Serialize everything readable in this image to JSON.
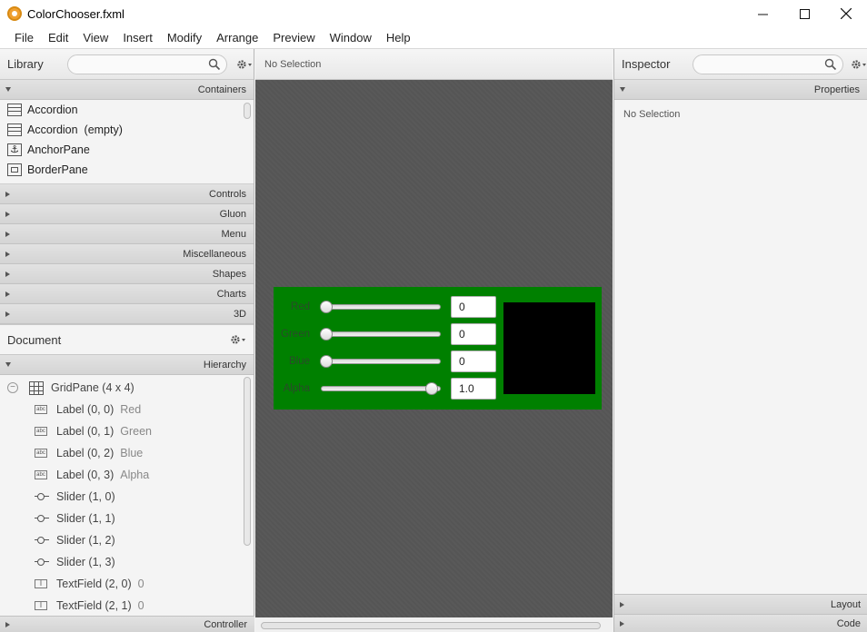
{
  "window": {
    "title": "ColorChooser.fxml"
  },
  "menu": [
    "File",
    "Edit",
    "View",
    "Insert",
    "Modify",
    "Arrange",
    "Preview",
    "Window",
    "Help"
  ],
  "library": {
    "title": "Library",
    "search_placeholder": "",
    "sections": {
      "containers": "Containers",
      "controls": "Controls",
      "gluon": "Gluon",
      "menu": "Menu",
      "misc": "Miscellaneous",
      "shapes": "Shapes",
      "charts": "Charts",
      "three_d": "3D"
    },
    "containers": [
      {
        "label": "Accordion",
        "icon": "accordion-icon"
      },
      {
        "label": "Accordion  (empty)",
        "icon": "accordion-icon"
      },
      {
        "label": "AnchorPane",
        "icon": "anchor-icon"
      },
      {
        "label": "BorderPane",
        "icon": "borderpane-icon"
      }
    ]
  },
  "document": {
    "title": "Document",
    "hierarchy_label": "Hierarchy",
    "controller_label": "Controller",
    "items": [
      {
        "label": "GridPane (4 x 4)",
        "extra": ""
      },
      {
        "label": "Label (0, 0)",
        "extra": "Red"
      },
      {
        "label": "Label (0, 1)",
        "extra": "Green"
      },
      {
        "label": "Label (0, 2)",
        "extra": "Blue"
      },
      {
        "label": "Label (0, 3)",
        "extra": "Alpha"
      },
      {
        "label": "Slider (1, 0)",
        "extra": ""
      },
      {
        "label": "Slider (1, 1)",
        "extra": ""
      },
      {
        "label": "Slider (1, 2)",
        "extra": ""
      },
      {
        "label": "Slider (1, 3)",
        "extra": ""
      },
      {
        "label": "TextField (2, 0)",
        "extra": "0"
      },
      {
        "label": "TextField (2, 1)",
        "extra": "0"
      }
    ]
  },
  "center": {
    "selection": "No Selection",
    "form": {
      "labels": [
        "Red",
        "Green",
        "Blue",
        "Alpha"
      ],
      "field_values": [
        "0",
        "0",
        "0",
        "1.0"
      ],
      "slider_levels": [
        0,
        0,
        0,
        1
      ],
      "background_color": "#008000",
      "swatch_color": "#000000"
    }
  },
  "inspector": {
    "title": "Inspector",
    "properties_label": "Properties",
    "no_selection": "No Selection",
    "layout_label": "Layout",
    "code_label": "Code"
  }
}
